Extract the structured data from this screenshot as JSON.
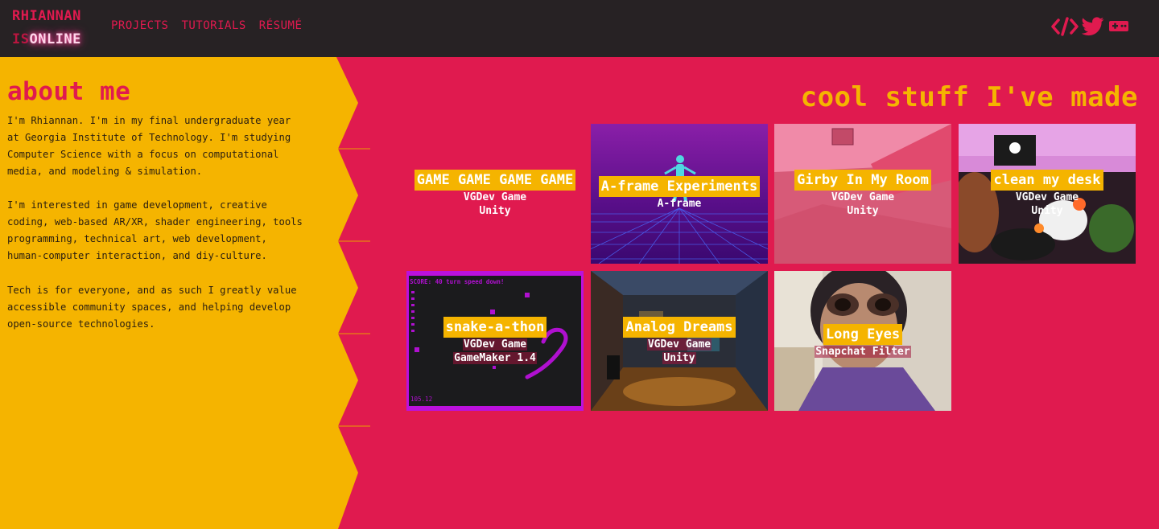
{
  "header": {
    "logo_line1": "RHIANNAN",
    "logo_line2_prefix": "IS",
    "logo_line2_glow": "ONLINE",
    "nav": [
      {
        "label": "PROJECTS"
      },
      {
        "label": "TUTORIALS"
      },
      {
        "label": "RÉSUMÉ"
      }
    ],
    "social_icons": [
      "code-icon",
      "twitter-icon",
      "gamepad-icon"
    ]
  },
  "about": {
    "heading": "about me",
    "paragraphs": [
      "I'm Rhiannan. I'm in my final undergraduate year at Georgia Institute of Technology. I'm studying Computer Science with a focus on computational media, and modeling & simulation.",
      "I'm interested in game development, creative coding, web-based AR/XR, shader engineering, tools programming, technical art, web development, human-computer interaction, and diy-culture.",
      "Tech is for everyone, and as such I greatly value accessible community spaces, and helping develop open-source technologies."
    ]
  },
  "projects": {
    "heading": "cool stuff I've made",
    "items": [
      {
        "title": "GAME GAME GAME GAME",
        "tags": [
          "VGDev Game",
          "Unity"
        ]
      },
      {
        "title": "A-frame Experiments",
        "tags": [
          "A-frame"
        ]
      },
      {
        "title": "Girby In My Room",
        "tags": [
          "VGDev Game",
          "Unity"
        ]
      },
      {
        "title": "clean my desk",
        "tags": [
          "VGDev Game",
          "Unity"
        ]
      },
      {
        "title": "snake-a-thon",
        "tags": [
          "VGDev Game",
          "GameMaker 1.4"
        ],
        "score_text": "SCORE: 40 turn speed down!",
        "footer_text": "105.12"
      },
      {
        "title": "Analog Dreams",
        "tags": [
          "VGDev Game",
          "Unity"
        ]
      },
      {
        "title": "Long Eyes",
        "tags": [
          "Snapchat Filter"
        ]
      }
    ]
  },
  "colors": {
    "background": "#e01a4f",
    "panel": "#f5b400",
    "topbar": "#272224",
    "accent": "#f5b400"
  }
}
